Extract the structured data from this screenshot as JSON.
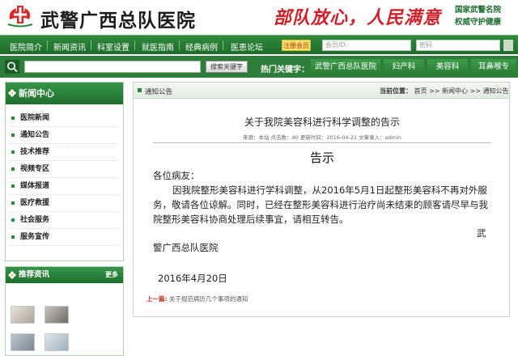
{
  "header": {
    "site_title": "武警广西总队医院",
    "slogan": "部队放心，人民满意",
    "badge_line1": "国家武警名院",
    "badge_line2": "权威守护健康",
    "logo_icon": "red-cross-emblem-icon"
  },
  "main_nav": {
    "items": [
      "医院简介",
      "新闻资讯",
      "科室设置",
      "就医指南",
      "经典病例",
      "医患论坛"
    ],
    "login_tag": "注册会员",
    "member_id_placeholder": "会员ID:",
    "password_placeholder": "密码"
  },
  "search": {
    "button_label": "搜索关键字",
    "hot_label": "热门关键字：",
    "hot_tabs": [
      "武警广西总队医院",
      "妇产科",
      "美容科",
      "耳鼻喉专"
    ]
  },
  "sidebar": {
    "title": "新闻中心",
    "items": [
      {
        "label": "医院新闻"
      },
      {
        "label": "通知公告"
      },
      {
        "label": "技术推荐"
      },
      {
        "label": "视频专区"
      },
      {
        "label": "媒体报道"
      },
      {
        "label": "医疗救援"
      },
      {
        "label": "社会服务"
      },
      {
        "label": "服务宣传"
      }
    ],
    "recommend_title": "推荐资讯",
    "recommend_more": "更多"
  },
  "content": {
    "breadcrumb_left": "通知公告",
    "location_label": "当前位置：",
    "crumbs": [
      "首页",
      "新闻中心",
      "通知公告"
    ],
    "crumb_sep": ">>",
    "article_title": "关于我院美容科进行科学调整的告示",
    "article_meta": "来源：本站 点击数：40 更新时间：2016-04-21 文章录入：admin",
    "notice_title": "告示",
    "greeting": "各位病友：",
    "paragraph": "因我院整形美容科进行学科调整，从2016年5月1日起整形美容科不再对外服务，敬请各位谅解。同时，已经在整形美容科进行治疗尚未结束的顾客请尽早与我院整形美容科协商处理后续事宜，请相互转告。",
    "sign_part1": "武",
    "sign_part2": "警广西总队医院",
    "date": "2016年4月20日",
    "prev_label": "上一篇:",
    "prev_title": "关于规范病历几个事项的通知"
  },
  "colors": {
    "brand_green": "#2f7d3a",
    "slogan_red": "#d0202a",
    "badge_green": "#1d6c2f"
  }
}
